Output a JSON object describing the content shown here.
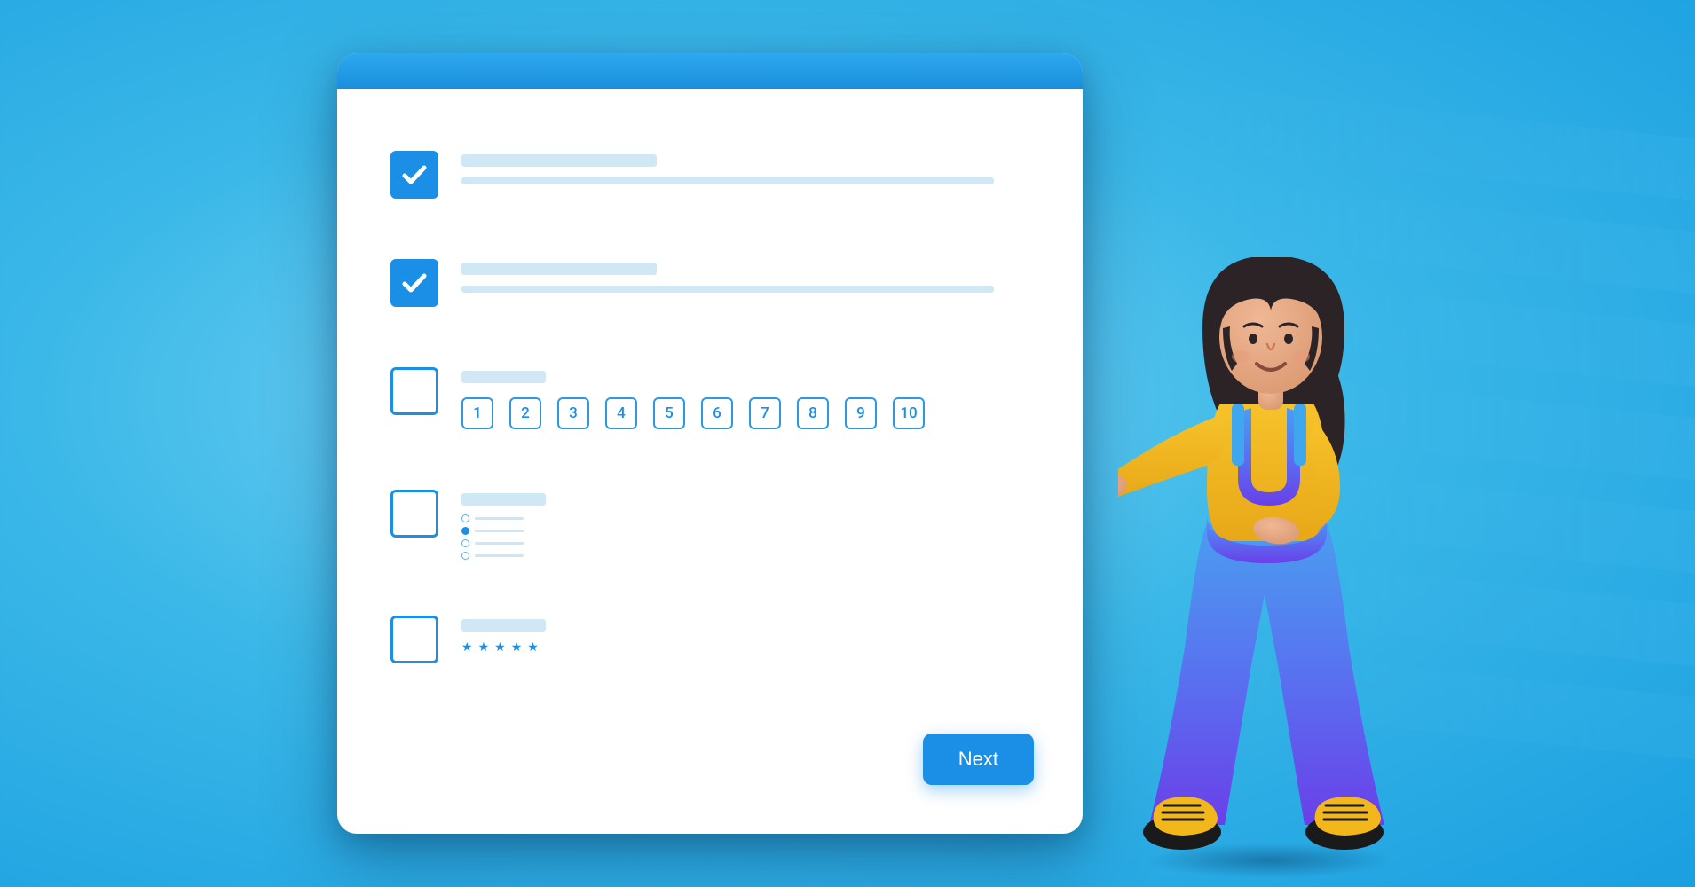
{
  "survey": {
    "items": [
      {
        "type": "checkbox",
        "checked": true,
        "kind": "text"
      },
      {
        "type": "checkbox",
        "checked": true,
        "kind": "text"
      },
      {
        "type": "checkbox",
        "checked": false,
        "kind": "scale"
      },
      {
        "type": "checkbox",
        "checked": false,
        "kind": "radio"
      },
      {
        "type": "checkbox",
        "checked": false,
        "kind": "stars"
      }
    ],
    "scale_values": [
      "1",
      "2",
      "3",
      "4",
      "5",
      "6",
      "7",
      "8",
      "9",
      "10"
    ],
    "radio_selected_index": 1,
    "radio_option_count": 4,
    "star_count": 5,
    "next_label": "Next"
  },
  "colors": {
    "accent": "#1b8fe6",
    "placeholder": "#d0e8f6"
  }
}
